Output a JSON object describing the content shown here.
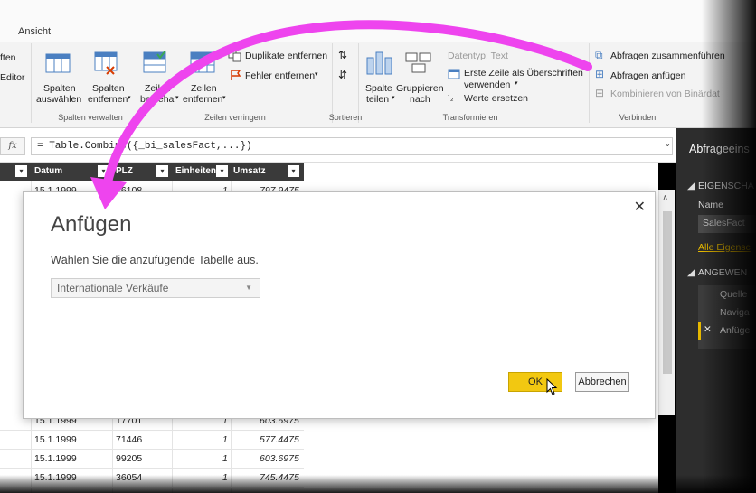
{
  "ribbon": {
    "tab_ansicht": "Ansicht",
    "left_cut_1": "ften",
    "left_cut_2": "Editor",
    "spalten_auswaehlen": [
      "Spalten",
      "auswählen"
    ],
    "spalten_entfernen": [
      "Spalten",
      "entfernen"
    ],
    "zeilen_beibehalten": [
      "Zeilen",
      "beibehal"
    ],
    "zeilen_entfernen": [
      "Zeilen",
      "entfernen"
    ],
    "duplikate": "Duplikate entfernen",
    "fehler": "Fehler entfernen",
    "spalte_teilen": [
      "Spalte",
      "teilen"
    ],
    "gruppieren": [
      "Gruppieren",
      "nach"
    ],
    "datentyp": "Datentyp: Text",
    "erste_zeile": [
      "Erste Zeile als Überschriften",
      "verwenden"
    ],
    "werte_ersetzen": "Werte ersetzen",
    "abfragen_zusammen": "Abfragen zusammenführen",
    "abfragen_anfuegen": "Abfragen anfügen",
    "kombinieren": "Kombinieren von Binärdat",
    "groups": {
      "spalten_verwalten": "Spalten verwalten",
      "zeilen_verringern": "Zeilen verringern",
      "sortieren": "Sortieren",
      "transformieren": "Transformieren",
      "verbinden": "Verbinden"
    },
    "colors": {
      "accent": "#f2c811",
      "arrow": "#ee44ee"
    }
  },
  "formula": {
    "fx": "fx",
    "text": "= Table.Combine({_bi_salesFact,...})"
  },
  "grid": {
    "headers": [
      "Datum",
      "PLZ",
      "Einheiten",
      "Umsatz"
    ],
    "rows_top": [
      [
        "15.1.1999",
        "26108",
        "1",
        "797.9475"
      ]
    ],
    "rows_bottom": [
      [
        "15.1.1999",
        "17701",
        "1",
        "603.6975"
      ],
      [
        "15.1.1999",
        "71446",
        "1",
        "577.4475"
      ],
      [
        "15.1.1999",
        "99205",
        "1",
        "603.6975"
      ],
      [
        "15.1.1999",
        "36054",
        "1",
        "745.4475"
      ]
    ]
  },
  "right_panel": {
    "title": "Abfrageeins",
    "eigenschaften": "EIGENSCHA",
    "name_label": "Name",
    "name_value": "SalesFact",
    "alle": "Alle Eigensc",
    "angewendete": "ANGEWEN",
    "steps": [
      "Quelle",
      "Naviga",
      "Anfüge"
    ]
  },
  "dialog": {
    "title": "Anfügen",
    "prompt": "Wählen Sie die anzufügende Tabelle aus.",
    "select_value": "Internationale Verkäufe",
    "ok": "OK",
    "cancel": "Abbrechen"
  }
}
